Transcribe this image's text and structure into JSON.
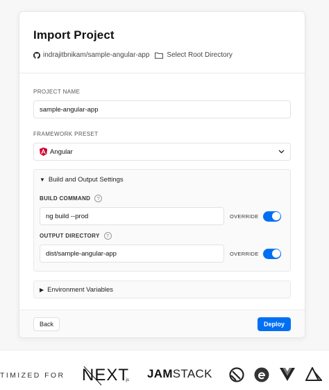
{
  "title": "Import Project",
  "repo": {
    "name": "indrajitbnikam/sample-angular-app",
    "icon": "github-icon"
  },
  "root": {
    "label": "Select Root Directory",
    "icon": "folder-icon"
  },
  "project_name": {
    "label": "PROJECT NAME",
    "value": "sample-angular-app"
  },
  "framework": {
    "label": "FRAMEWORK PRESET",
    "value": "Angular",
    "icon": "angular-icon",
    "accent": "#dd0031"
  },
  "build": {
    "title": "Build and Output Settings",
    "command": {
      "label": "BUILD COMMAND",
      "value": "ng build --prod",
      "override": "OVERRIDE",
      "enabled": true
    },
    "output": {
      "label": "OUTPUT DIRECTORY",
      "value": "dist/sample-angular-app",
      "override": "OVERRIDE",
      "enabled": true
    }
  },
  "env": {
    "title": "Environment Variables"
  },
  "footer": {
    "back": "Back",
    "deploy": "Deploy"
  },
  "colors": {
    "primary": "#0070f3"
  },
  "strip": {
    "text": "TIMIZED FOR",
    "next_logo": "NEXT",
    "next_sub": ".js",
    "jamstack_bold": "JAM",
    "jamstack_rest": "STACK",
    "icons": [
      "gatsby-icon",
      "eleventy-icon",
      "vue-icon",
      "nuxt-icon"
    ]
  }
}
